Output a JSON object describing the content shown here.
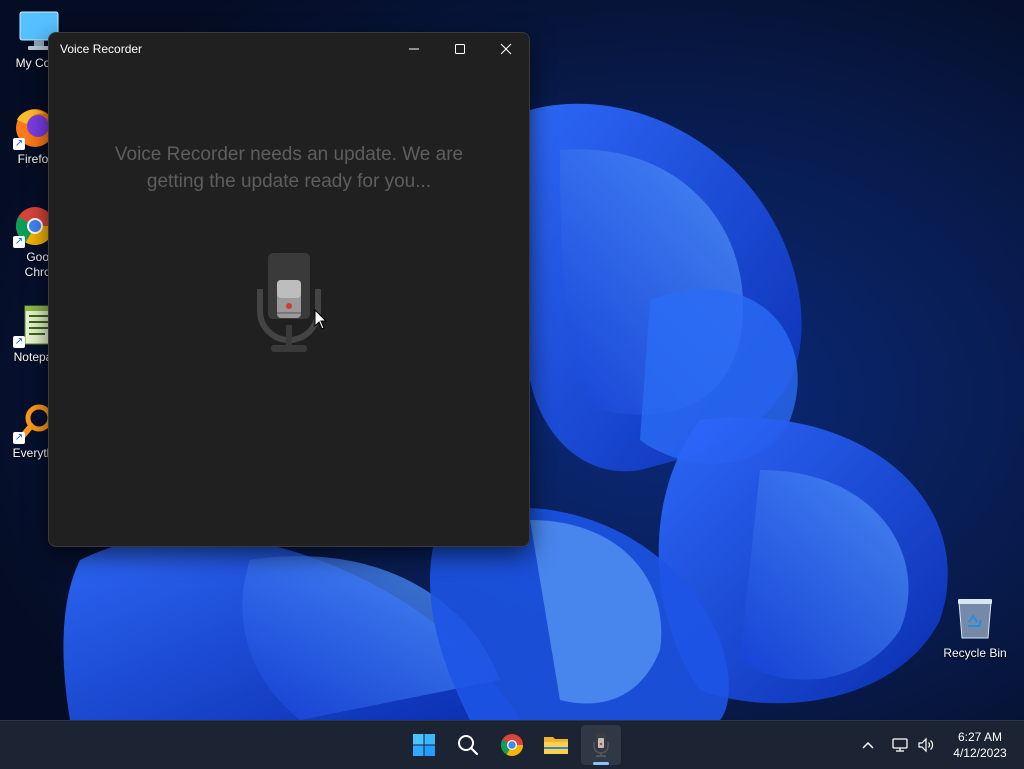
{
  "desktop": {
    "icons": [
      {
        "label": "My Com"
      },
      {
        "label": "Firefo"
      },
      {
        "label": "Goog Chron"
      },
      {
        "label": "Notepa"
      },
      {
        "label": "Everyth"
      }
    ],
    "recycle_bin": {
      "label": "Recycle Bin"
    }
  },
  "window": {
    "title": "Voice Recorder",
    "message": "Voice Recorder needs an update. We are getting the update ready for you..."
  },
  "taskbar": {
    "apps": [
      "start-icon",
      "search-icon",
      "chrome-icon",
      "file-explorer-icon",
      "voice-recorder-icon"
    ],
    "tray": {
      "time": "6:27 AM",
      "date": "4/12/2023"
    }
  },
  "colors": {
    "window_bg": "#202020",
    "message_text": "#5e5e5e",
    "taskbar_bg": "#1c2433",
    "accent": "#8bc2ff"
  }
}
